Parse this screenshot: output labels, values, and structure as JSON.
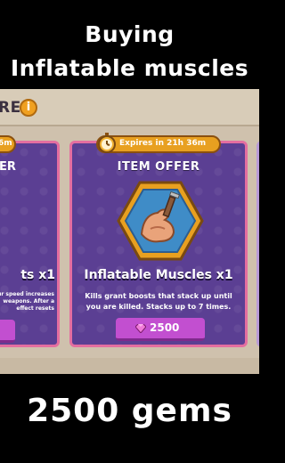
{
  "captions": {
    "line1": "Buying",
    "line2": "Inflatable muscles",
    "line3": "2500 gems"
  },
  "store": {
    "title_partial": "RE",
    "info_icon": "info-icon"
  },
  "left_card": {
    "badge_partial": "6m",
    "title_partial": "ER",
    "name_partial": "ts x1",
    "desc_partial": "ur speed increases weapons. After a effect resets"
  },
  "offer": {
    "expires": "Expires in 21h 36m",
    "title": "ITEM OFFER",
    "item_name": "Inflatable Muscles x1",
    "description": "Kills grant boosts that stack up until you are killed. Stacks up to 7 times.",
    "price": "2500",
    "price_icon": "gem-icon",
    "item_icon": "flexed-arm-icon"
  },
  "colors": {
    "card_bg": "#5b3f93",
    "card_border": "#e46ea0",
    "button": "#c24fd0",
    "badge": "#e8a020",
    "hex_frame": "#e8a020"
  }
}
